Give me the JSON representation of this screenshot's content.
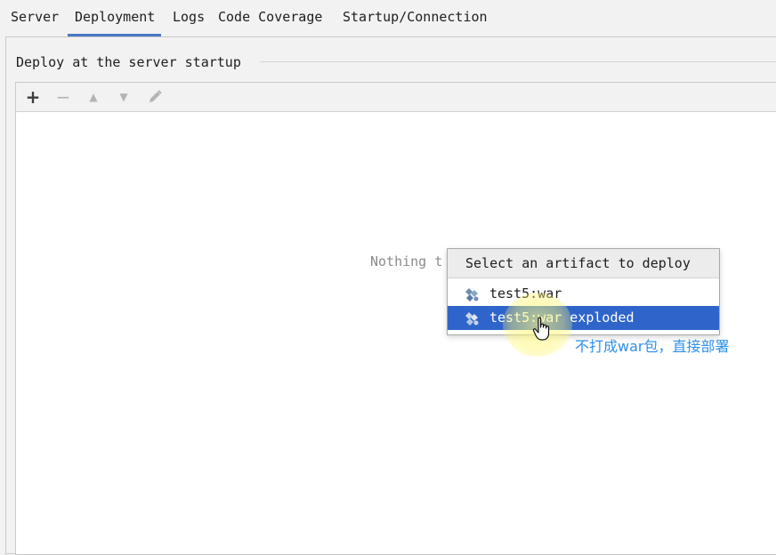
{
  "tabs": [
    {
      "label": "Server"
    },
    {
      "label": "Deployment",
      "active": true
    },
    {
      "label": "Logs"
    },
    {
      "label": "Code Coverage"
    },
    {
      "label": "Startup/Connection"
    }
  ],
  "deploy_section": {
    "title": "Deploy at the server startup",
    "toolbar": {
      "add": "+",
      "remove": "−",
      "move_up": "▲",
      "move_down": "▼",
      "edit": "edit-icon"
    },
    "empty_text": "Nothing t"
  },
  "artifact_popup": {
    "title": "Select an artifact to deploy",
    "items": [
      {
        "label": "test5:war",
        "icon": "artifact-icon",
        "selected": false
      },
      {
        "label": "test5:war exploded",
        "icon": "artifact-icon",
        "selected": true
      }
    ]
  },
  "annotation": "不打成war包，直接部署",
  "colors": {
    "accent": "#4a78c4",
    "selection": "#2f65ca",
    "annotation": "#2f8fe8"
  }
}
